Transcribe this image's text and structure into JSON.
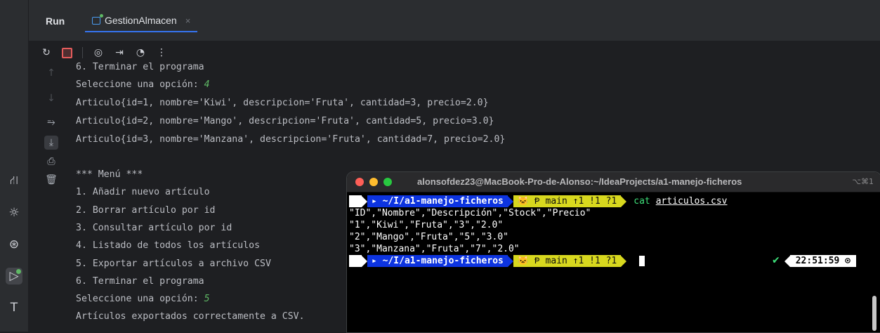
{
  "run_panel": {
    "label": "Run",
    "tab": {
      "title": "GestionAlmacen",
      "close": "×"
    }
  },
  "console": {
    "lines": [
      "6. Terminar el programa",
      "Seleccione una opción: ",
      "Articulo{id=1, nombre='Kiwi', descripcion='Fruta', cantidad=3, precio=2.0}",
      "Articulo{id=2, nombre='Mango', descripcion='Fruta', cantidad=5, precio=3.0}",
      "Articulo{id=3, nombre='Manzana', descripcion='Fruta', cantidad=7, precio=2.0}",
      "*** Menú ***",
      "1. Añadir nuevo artículo",
      "2. Borrar artículo por id",
      "3. Consultar artículo por id",
      "4. Listado de todos los artículos",
      "5. Exportar artículos a archivo CSV",
      "6. Terminar el programa",
      "Seleccione una opción: ",
      "Artículos exportados correctamente a CSV."
    ],
    "input_1": "4",
    "input_2": "5"
  },
  "terminal": {
    "title": "alonsofdez23@MacBook-Pro-de-Alonso:~/IdeaProjects/a1-manejo-ficheros",
    "shortcut": "⌥⌘1",
    "prompt": {
      "apple": "",
      "dir_prefix": "▸ ~/I/",
      "dir_name": "a1-manejo-ficheros",
      "git": "🐱 Ᵽ main ↑1 !1 ?1"
    },
    "command": "cat",
    "command_arg": "articulos.csv",
    "output": [
      "\"ID\",\"Nombre\",\"Descripción\",\"Stock\",\"Precio\"",
      "\"1\",\"Kiwi\",\"Fruta\",\"3\",\"2.0\"",
      "\"2\",\"Mango\",\"Fruta\",\"5\",\"3.0\"",
      "\"3\",\"Manzana\",\"Fruta\",\"7\",\"2.0\""
    ],
    "status_check": "✔",
    "time": "22:51:59 ⊙"
  },
  "icons": {
    "left_strip": [
      "build-icon",
      "debug-icon",
      "services-icon",
      "run-icon",
      "hammer-icon"
    ],
    "toolbar": [
      "rerun-icon",
      "stop-icon",
      "screenshot-icon",
      "export-icon",
      "profiler-icon",
      "more-icon"
    ]
  }
}
